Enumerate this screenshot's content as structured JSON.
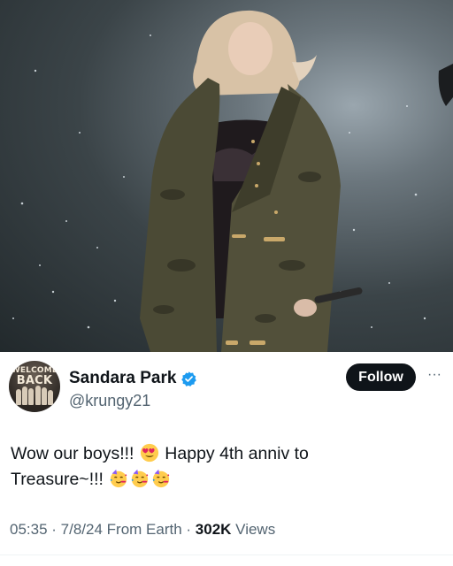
{
  "media": {
    "kind": "concert-photo"
  },
  "author": {
    "display_name": "Sandara Park",
    "handle": "@krungy21",
    "verified": true,
    "avatar_text_top": "WELCOME",
    "avatar_text_main": "BACK"
  },
  "actions": {
    "follow_label": "Follow",
    "more_label": "···"
  },
  "tweet": {
    "line1_a": "Wow our boys!!!",
    "line1_b": "Happy 4th anniv to",
    "line2": "Treasure~!!!"
  },
  "meta": {
    "time": "05:35",
    "sep1": " · ",
    "date": "7/8/24",
    "location": "From Earth",
    "sep2": " · ",
    "views_count": "302K",
    "views_label": "Views"
  },
  "icons": {
    "verified": "verified-badge-icon",
    "heart_eyes": "heart-eyes-emoji",
    "party": "partying-face-emoji"
  },
  "colors": {
    "accent": "#1d9bf0",
    "text": "#0f1419",
    "muted": "#536471",
    "button": "#0f1419"
  }
}
